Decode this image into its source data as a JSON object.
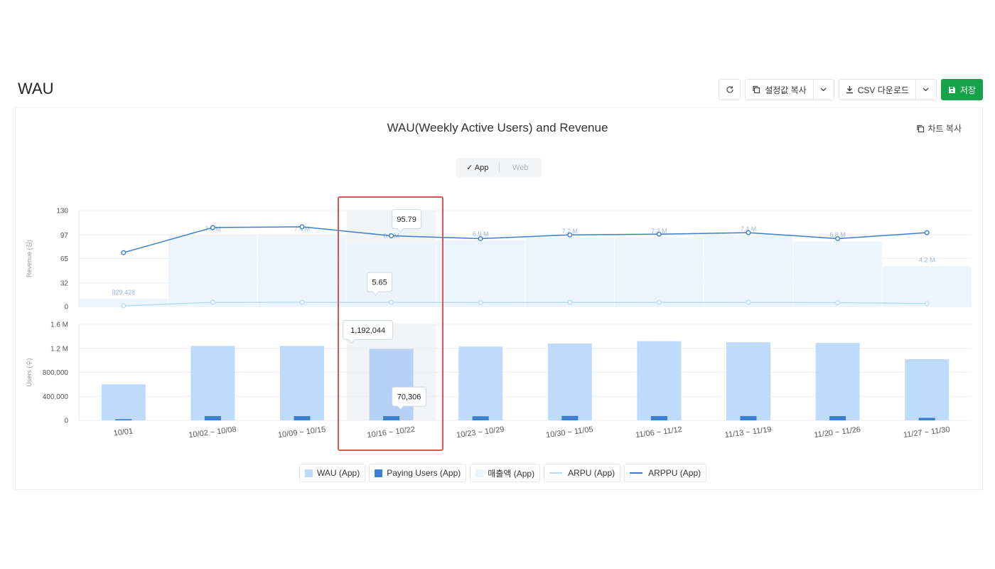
{
  "page": {
    "title": "WAU",
    "toolbar": {
      "copy_settings_label": "설정값 복사",
      "csv_download_label": "CSV 다운로드",
      "save_label": "저장"
    }
  },
  "chart_header": {
    "copy_chart_label": "차트 복사",
    "toggle_options": [
      "App",
      "Web"
    ],
    "toggle_selected": "App",
    "toggle_check": "✓"
  },
  "legend": [
    {
      "label": "WAU (App)",
      "color": "#bfdbfb",
      "kind": "box"
    },
    {
      "label": "Paying Users (App)",
      "color": "#3b7fd0",
      "kind": "box"
    },
    {
      "label": "매출액 (App)",
      "color": "#eaf3fd",
      "kind": "box"
    },
    {
      "label": "ARPU (App)",
      "color": "#b7dcf6",
      "kind": "line"
    },
    {
      "label": "ARPPU (App)",
      "color": "#3d7ecc",
      "kind": "line"
    }
  ],
  "colors": {
    "wau": "#bfdbfb",
    "paying": "#3b7fd0",
    "revenue_area": "#eaf3fd",
    "arpu": "#b7dcf6",
    "arppu": "#3d7ecc",
    "highlight": "#e05252",
    "save_button": "#15a34a"
  },
  "chart_data": {
    "type": "bar",
    "title": "WAU(Weekly Active Users) and Revenue",
    "categories": [
      "10/01",
      "10/02 ~ 10/08",
      "10/09 ~ 10/15",
      "10/16 ~ 10/22",
      "10/23 ~ 10/29",
      "10/30 ~ 11/05",
      "11/06 ~ 11/12",
      "11/13 ~ 11/19",
      "11/20 ~ 11/26",
      "11/27 ~ 11/30"
    ],
    "upper_panel": {
      "ylabel": "Revenue (김)",
      "ylim": [
        0,
        130
      ],
      "yticks": [
        "0",
        "32",
        "65",
        "97",
        "130"
      ],
      "yticks_values": [
        0,
        32,
        65,
        97,
        130
      ],
      "revenue_labels": [
        "829,428",
        "7.4 M",
        "7.4 M",
        "6.7 M",
        "6.9 M",
        "7.2 M",
        "7.2 M",
        "7.4 M",
        "6.8 M",
        "4.2 M"
      ],
      "revenue_values": [
        829428,
        7400000,
        7400000,
        6700000,
        6900000,
        7200000,
        7200000,
        7400000,
        6800000,
        4200000
      ],
      "revenue_max": 10000000,
      "series": [
        {
          "name": "ARPPU (App)",
          "values": [
            73,
            107,
            108,
            95.79,
            92,
            97,
            98,
            100,
            92,
            100
          ]
        },
        {
          "name": "ARPU (App)",
          "values": [
            1,
            5.7,
            5.8,
            5.65,
            5.4,
            5.6,
            5.6,
            5.6,
            5.3,
            4
          ]
        }
      ]
    },
    "lower_panel": {
      "ylabel": "Users (수)",
      "ylim": [
        0,
        1600000
      ],
      "yticks": [
        "0",
        "400,000",
        "800,000",
        "1.2 M",
        "1.6 M"
      ],
      "yticks_values": [
        0,
        400000,
        800000,
        1200000,
        1600000
      ],
      "series": [
        {
          "name": "WAU (App)",
          "values": [
            600000,
            1240000,
            1240000,
            1192044,
            1230000,
            1280000,
            1320000,
            1300000,
            1290000,
            1020000
          ]
        },
        {
          "name": "Paying Users (App)",
          "values": [
            20000,
            72000,
            70000,
            70306,
            68000,
            74000,
            72000,
            72000,
            71000,
            42000
          ]
        }
      ]
    },
    "tooltips": {
      "category": "10/16 ~ 10/22",
      "arppu": "95.79",
      "arpu": "5.65",
      "wau": "1,192,044",
      "paying": "70,306"
    },
    "highlighted_category": "10/16 ~ 10/22",
    "grid": true,
    "legend_position": "bottom"
  }
}
